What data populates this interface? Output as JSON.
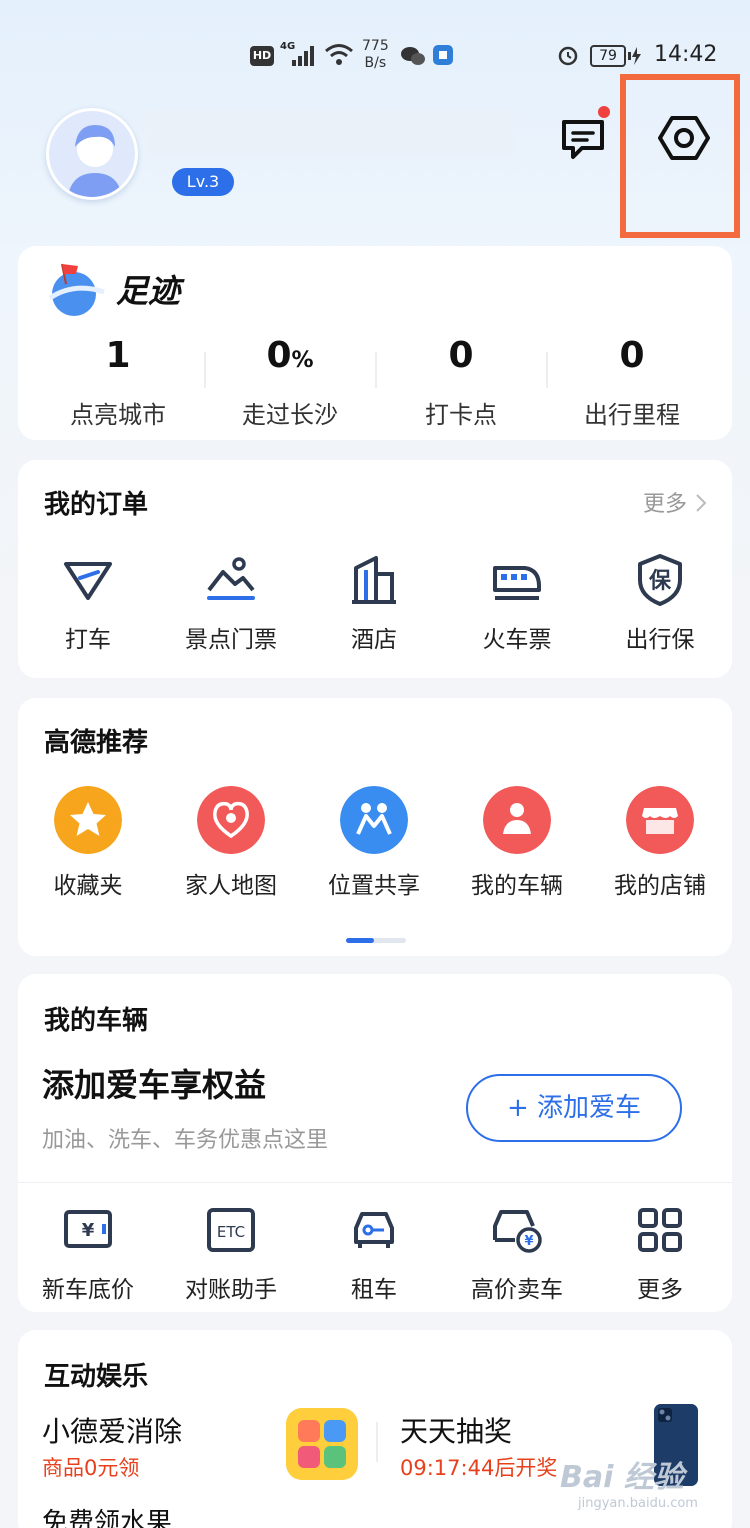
{
  "status_bar": {
    "hd": "HD",
    "network": "4G",
    "speed_value": "775",
    "speed_unit": "B/s",
    "battery": "79",
    "time": "14:42"
  },
  "profile": {
    "level": "Lv.3",
    "has_unread_messages": true
  },
  "footprint": {
    "title": "足迹",
    "stats": [
      {
        "value": "1",
        "unit": "",
        "label": "点亮城市"
      },
      {
        "value": "0",
        "unit": "%",
        "label": "走过长沙"
      },
      {
        "value": "0",
        "unit": "",
        "label": "打卡点"
      },
      {
        "value": "0",
        "unit": "",
        "label": "出行里程"
      }
    ]
  },
  "orders": {
    "title": "我的订单",
    "more": "更多",
    "items": [
      {
        "label": "打车",
        "icon": "taxi-icon"
      },
      {
        "label": "景点门票",
        "icon": "scenic-ticket-icon"
      },
      {
        "label": "酒店",
        "icon": "hotel-icon"
      },
      {
        "label": "火车票",
        "icon": "train-icon"
      },
      {
        "label": "出行保",
        "icon": "insurance-icon"
      }
    ]
  },
  "recommend": {
    "title": "高德推荐",
    "items": [
      {
        "label": "收藏夹",
        "icon": "star-icon",
        "color": "#f7a51c"
      },
      {
        "label": "家人地图",
        "icon": "family-map-icon",
        "color": "#f25a5a"
      },
      {
        "label": "位置共享",
        "icon": "location-share-icon",
        "color": "#3a8df0"
      },
      {
        "label": "我的车辆",
        "icon": "my-vehicle-icon",
        "color": "#f25a5a"
      },
      {
        "label": "我的店铺",
        "icon": "my-shop-icon",
        "color": "#f25a5a"
      }
    ],
    "page": 1,
    "page_count": 2
  },
  "vehicle": {
    "title": "我的车辆",
    "headline": "添加爱车享权益",
    "sub": "加油、洗车、车务优惠点这里",
    "add_button": "+ 添加爱车",
    "items": [
      {
        "label": "新车底价",
        "icon": "new-car-price-icon"
      },
      {
        "label": "对账助手",
        "icon": "etc-icon"
      },
      {
        "label": "租车",
        "icon": "car-rental-icon"
      },
      {
        "label": "高价卖车",
        "icon": "sell-car-icon"
      },
      {
        "label": "更多",
        "icon": "more-grid-icon"
      }
    ]
  },
  "fun": {
    "title": "互动娱乐",
    "game1_title": "小德爱消除",
    "game1_sub": "商品0元领",
    "game2_title": "天天抽奖",
    "game2_sub": "09:17:44后开奖",
    "next_title": "免费领水果"
  },
  "watermark": {
    "main": "Bai 经验",
    "sub": "jingyan.baidu.com"
  },
  "colors": {
    "accent": "#2c6fe8",
    "highlight": "#f26a3e",
    "promo_red": "#e8401c"
  }
}
